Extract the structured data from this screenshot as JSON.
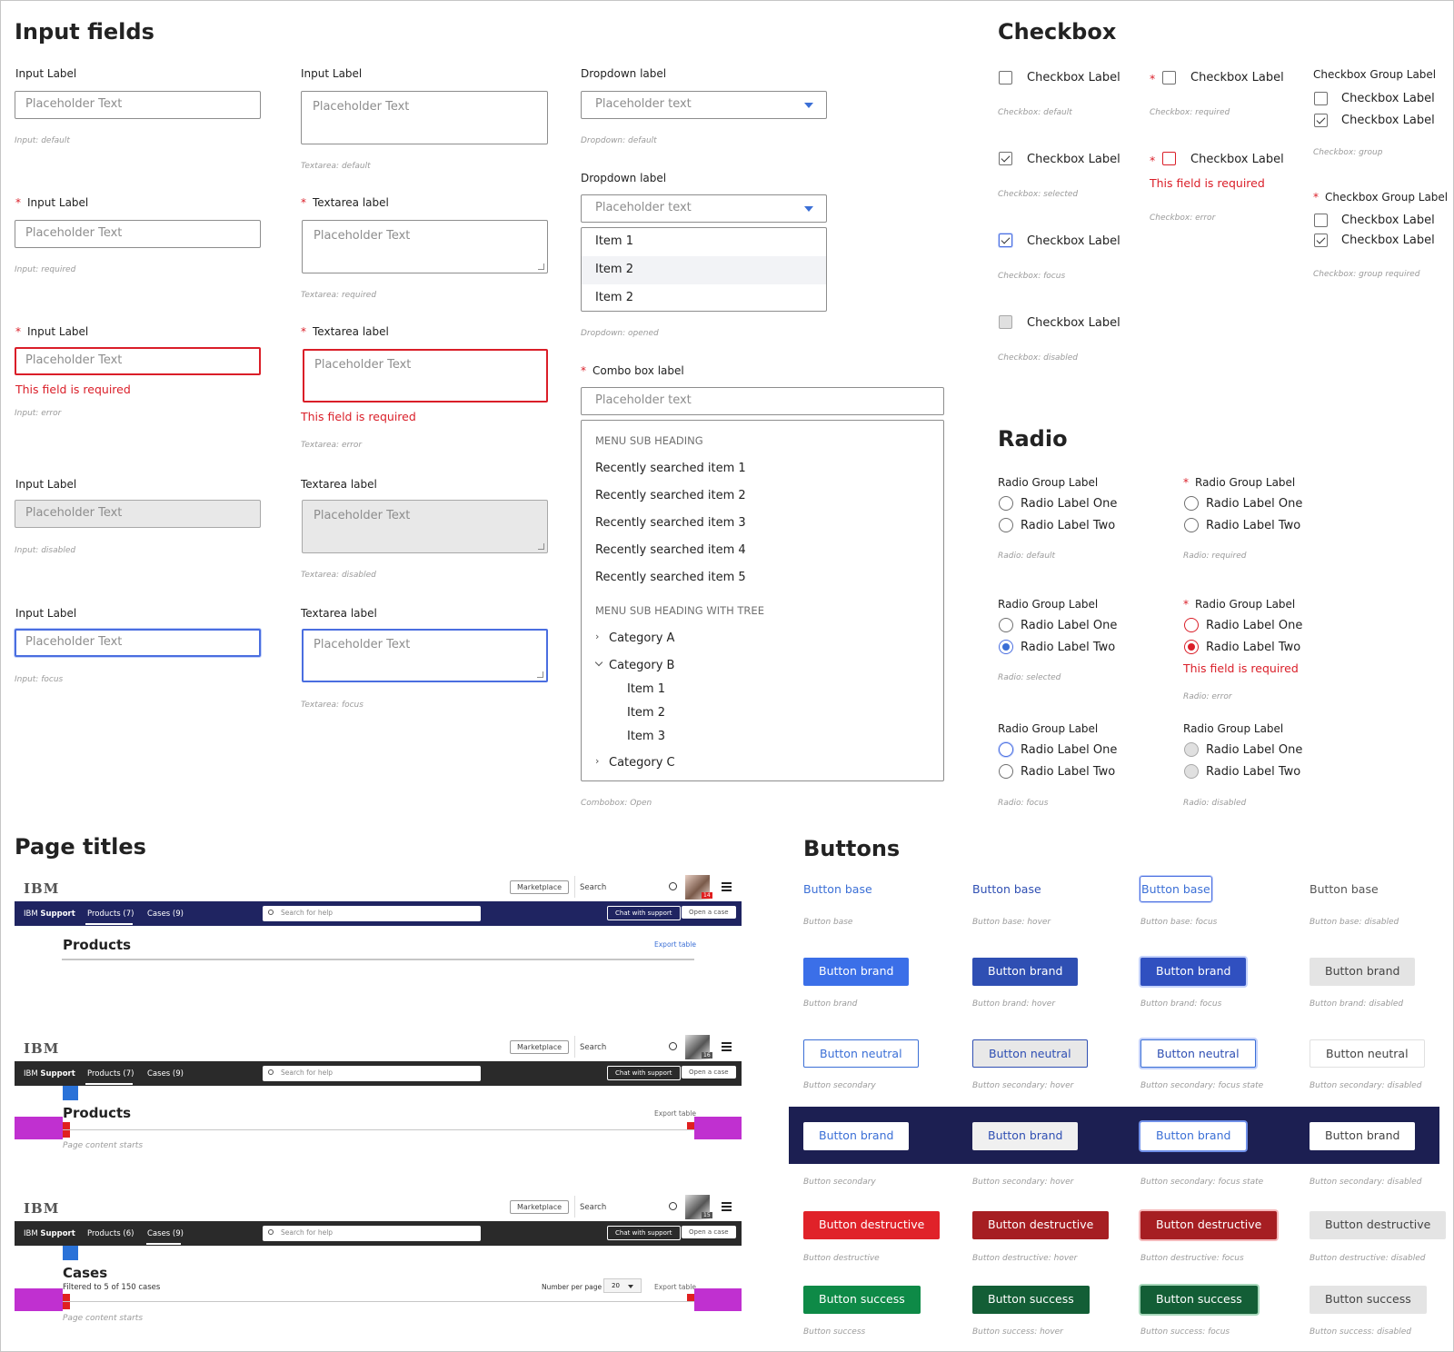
{
  "input_fields": {
    "title": "Input fields",
    "input_label": "Input Label",
    "textarea_label_default": "Input Label",
    "textarea_label": "Textarea label",
    "placeholder": "Placeholder Text",
    "error_msg": "This field is required",
    "captions": {
      "input_default": "Input: default",
      "input_required": "Input: required",
      "input_error": "Input: error",
      "input_disabled": "Input: disabled",
      "input_focus": "Input: focus",
      "ta_default": "Textarea: default",
      "ta_required": "Textarea: required",
      "ta_error": "Textarea: error",
      "ta_disabled": "Textarea: disabled",
      "ta_focus": "Textarea: focus"
    },
    "required_mark": "*"
  },
  "dropdown": {
    "label": "Dropdown label",
    "placeholder": "Placeholder text",
    "caption_default": "Dropdown: default",
    "caption_opened": "Dropdown: opened",
    "items": [
      "Item 1",
      "Item 2",
      "Item 2"
    ]
  },
  "combobox": {
    "label": "Combo box label",
    "placeholder": "Placeholder text",
    "sub_heading": "MENU SUB HEADING",
    "recent": [
      "Recently searched item 1",
      "Recently searched item 2",
      "Recently searched item 3",
      "Recently searched item 4",
      "Recently searched item 5"
    ],
    "sub_heading_tree": "MENU SUB HEADING WITH TREE",
    "category_a": "Category A",
    "category_b": "Category B",
    "tree_items": [
      "Item 1",
      "Item 2",
      "Item 3"
    ],
    "category_c": "Category C",
    "caption": "Combobox: Open"
  },
  "checkbox": {
    "title": "Checkbox",
    "label": "Checkbox Label",
    "group_label": "Checkbox Group Label",
    "error_msg": "This field is required",
    "captions": {
      "default": "Checkbox: default",
      "selected": "Checkbox: selected",
      "focus": "Checkbox: focus",
      "disabled": "Checkbox: disabled",
      "required": "Checkbox: required",
      "error": "Checkbox: error",
      "group": "Checkbox: group",
      "group_required": "Checkbox: group required"
    }
  },
  "radio": {
    "title": "Radio",
    "group_label": "Radio Group Label",
    "one": "Radio Label One",
    "two": "Radio Label Two",
    "error_msg": "This field is required",
    "captions": {
      "default": "Radio: default",
      "required": "Radio: required",
      "selected": "Radio: selected",
      "error": "Radio: error",
      "focus": "Radio: focus",
      "disabled": "Radio: disabled"
    }
  },
  "page_titles": {
    "title": "Page titles",
    "logo": "IBM",
    "marketplace": "Marketplace",
    "search": "Search",
    "brand": "IBM",
    "brand_bold": "Support",
    "products_tab_1": "Products (7)",
    "products_tab_3": "Products (6)",
    "cases_tab": "Cases (9)",
    "search_help": "Search for help",
    "chat": "Chat with support",
    "open_case": "Open a case",
    "products_title": "Products",
    "cases_title": "Cases",
    "export": "Export table",
    "content_starts": "Page content starts",
    "filtered": "Filtered to 5 of 150 cases",
    "per_page": "Number per page",
    "per_page_value": "20",
    "badge1": "14",
    "badge2": "16",
    "badge3": "15",
    "colors": {
      "nav_blue": "#1f2461",
      "nav_dark": "#2a2a2a",
      "magenta": "#c030d0",
      "marker_red": "#e02020",
      "marker_blue": "#2a72d8"
    }
  },
  "buttons": {
    "title": "Buttons",
    "base": "Button base",
    "brand": "Button brand",
    "neutral": "Button neutral",
    "destructive": "Button destructive",
    "success": "Button success",
    "captions": {
      "base": [
        "Button base",
        "Button base: hover",
        "Button base: focus",
        "Button base: disabled"
      ],
      "brand": [
        "Button brand",
        "Button brand: hover",
        "Button brand: focus",
        "Button brand: disabled"
      ],
      "neutral": [
        "Button secondary",
        "Button secondary: hover",
        "Button secondary: focus state",
        "Button secondary: disabled"
      ],
      "inverse": [
        "Button secondary",
        "Button secondary: hover",
        "Button secondary: focus state",
        "Button secondary: disabled"
      ],
      "destructive": [
        "Button destructive",
        "Button destructive: hover",
        "Button destructive: focus",
        "Button destructive: disabled"
      ],
      "success": [
        "Button success",
        "Button success: hover",
        "Button success: focus",
        "Button success: disabled"
      ]
    },
    "colors": {
      "brand": "#3b6fe8",
      "brand_hover": "#2f4fb3",
      "destructive": "#e02229",
      "destructive_hover": "#a61e22",
      "success": "#0e8a47",
      "success_hover": "#135e36",
      "dark_band": "#1c1f52",
      "disabled_bg": "#e4e4e4"
    }
  }
}
